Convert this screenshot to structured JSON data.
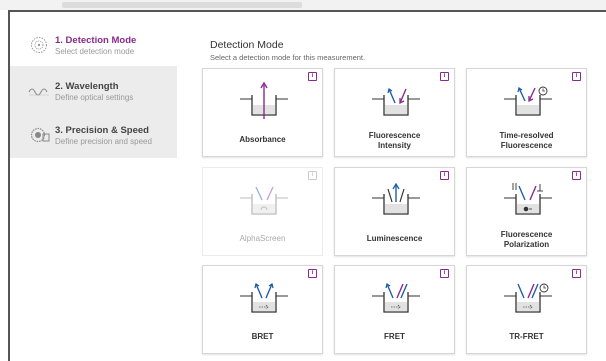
{
  "steps": [
    {
      "title": "1. Detection Mode",
      "subtitle": "Select detection mode"
    },
    {
      "title": "2. Wavelength",
      "subtitle": "Define optical settings"
    },
    {
      "title": "3. Precision & Speed",
      "subtitle": "Define precision and speed"
    }
  ],
  "main": {
    "title": "Detection Mode",
    "subtitle": "Select a detection mode for this measurement."
  },
  "modes": [
    {
      "line1": "Absorbance",
      "line2": ""
    },
    {
      "line1": "Fluorescence",
      "line2": "Intensity"
    },
    {
      "line1": "Time-resolved",
      "line2": "Fluorescence"
    },
    {
      "line1": "AlphaScreen",
      "line2": ""
    },
    {
      "line1": "Luminescence",
      "line2": ""
    },
    {
      "line1": "Fluorescence",
      "line2": "Polarization"
    },
    {
      "line1": "BRET",
      "line2": ""
    },
    {
      "line1": "FRET",
      "line2": ""
    },
    {
      "line1": "TR-FRET",
      "line2": ""
    }
  ],
  "info_glyph": "i",
  "colors": {
    "accent": "#8a2a8e",
    "blue": "#1f5fa8",
    "sidebar_bg": "#ececec",
    "disabled": "#bbbbbb"
  }
}
